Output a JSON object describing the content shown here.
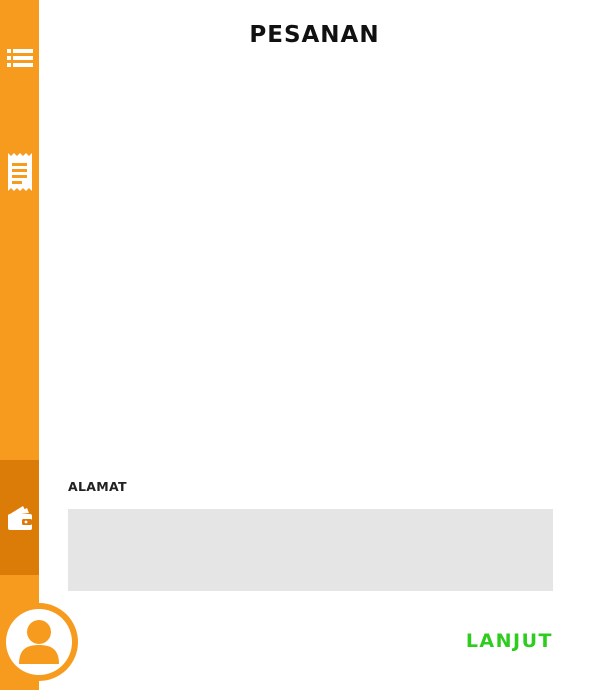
{
  "header": {
    "title": "PESANAN"
  },
  "sidebar": {
    "items": [
      {
        "icon": "list-icon",
        "active": false
      },
      {
        "icon": "receipt-icon",
        "active": false
      },
      {
        "icon": "wallet-icon",
        "active": true
      }
    ],
    "user_icon": "user-icon"
  },
  "form": {
    "address_label": "ALAMAT",
    "address_value": ""
  },
  "actions": {
    "next_label": "LANJUT"
  },
  "colors": {
    "sidebar": "#F79B1E",
    "sidebar_active": "#DB7C09",
    "accent_green": "#2ECC1E",
    "input_bg": "#E5E5E5"
  }
}
